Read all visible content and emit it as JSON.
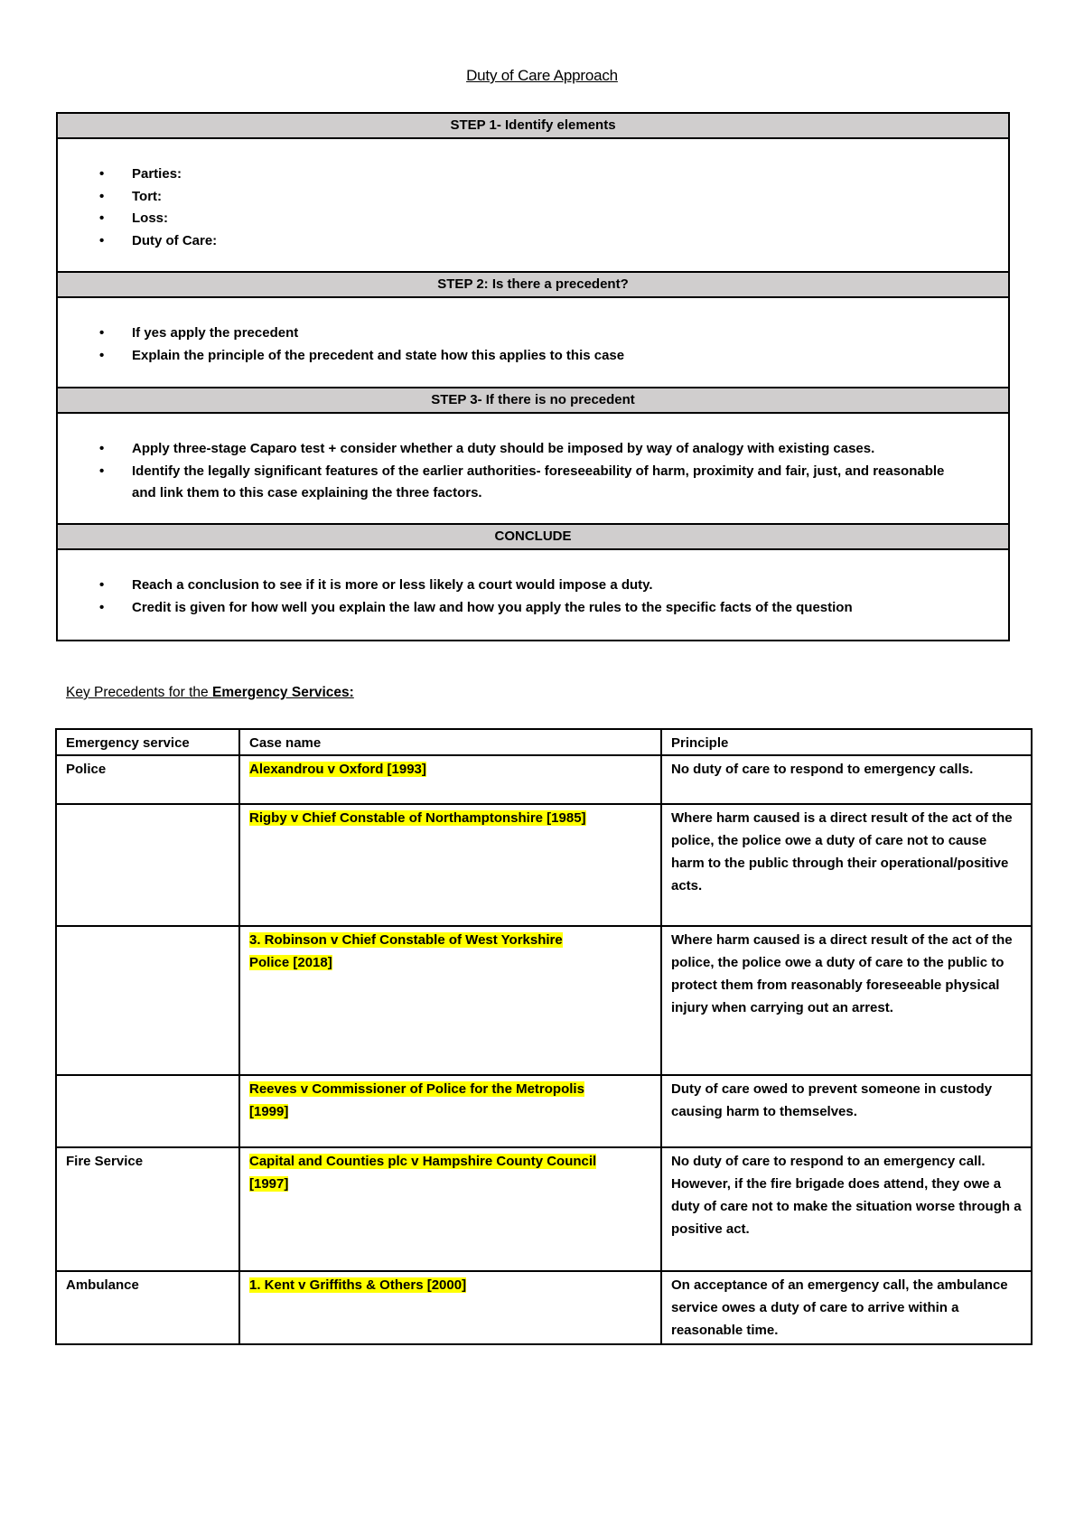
{
  "title": "Duty of Care Approach",
  "steps": [
    {
      "heading": "STEP 1- Identify elements",
      "items": [
        "Parties:",
        "Tort:",
        "Loss:",
        "Duty of Care:"
      ]
    },
    {
      "heading": "STEP 2: Is there a precedent?",
      "items": [
        "If yes apply the precedent",
        "Explain the principle of the precedent and state how this applies to this case"
      ]
    },
    {
      "heading": "STEP 3- If there is no precedent",
      "items": [
        "Apply three-stage Caparo test + consider whether a duty should be imposed by way of analogy with existing cases.",
        "Identify the legally significant features of the earlier authorities- foreseeability of harm, proximity and fair, just, and reasonable and link them to this case explaining the three factors."
      ]
    },
    {
      "heading": "CONCLUDE",
      "items": [
        "Reach a conclusion to see if it is more or less likely a court would impose a duty.",
        "Credit is given for how well you explain the law and how you apply the rules to the specific facts of the question"
      ]
    }
  ],
  "bullet_glyph": "•",
  "key_precedents": {
    "heading_prefix": "Key Precedents for the ",
    "heading_bold": "Emergency Services:",
    "highlight_color": "#ffff00",
    "columns": [
      "Emergency service",
      "Case name",
      "Principle"
    ],
    "rows": [
      {
        "service": "Police",
        "case_lines": [
          "Alexandrou v Oxford [1993]"
        ],
        "principle": "No duty of care to respond to emergency calls."
      },
      {
        "service": "",
        "case_lines": [
          "Rigby v Chief Constable of Northamptonshire [1985]"
        ],
        "principle": "Where harm caused is a direct result of the act of the police, the police owe a duty of care not to cause harm to the public through their operational/positive acts."
      },
      {
        "service": "",
        "case_lines": [
          "3. Robinson v Chief Constable of West Yorkshire",
          "Police [2018]"
        ],
        "principle": "Where harm caused is a direct result of the act of the police, the police owe a duty of care to the public to protect them from reasonably foreseeable physical injury when carrying out an arrest."
      },
      {
        "service": "",
        "case_lines": [
          "Reeves v Commissioner of Police for the Metropolis",
          "[1999]"
        ],
        "principle": "Duty of care owed to prevent someone in custody causing harm to themselves."
      },
      {
        "service": "Fire Service",
        "case_lines": [
          "Capital and Counties plc v Hampshire County Council",
          "[1997]"
        ],
        "principle": "No duty of care to respond to an emergency call. However, if the fire brigade does attend, they owe a duty of care not to make the situation worse through a positive act."
      },
      {
        "service": "Ambulance",
        "case_lines": [
          "1. Kent v Griffiths & Others [2000]"
        ],
        "principle": "On acceptance of an emergency call, the ambulance service owes a duty of care to arrive within a reasonable time."
      }
    ]
  }
}
